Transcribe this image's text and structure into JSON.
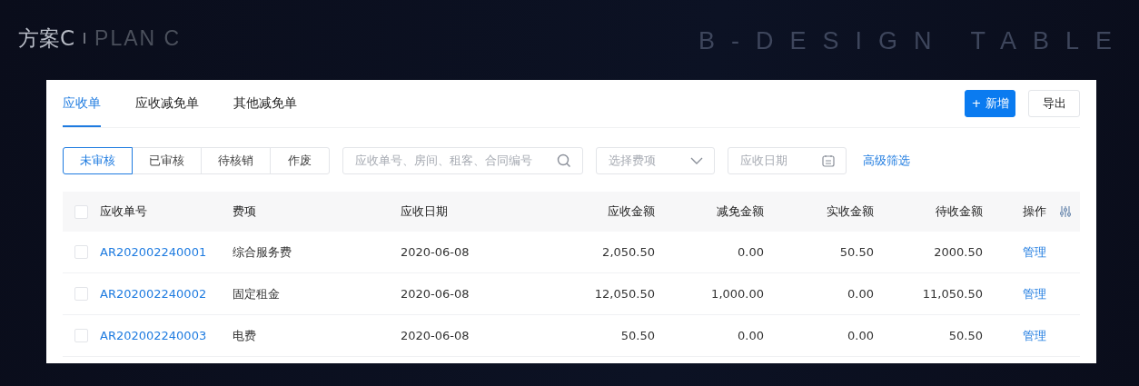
{
  "header": {
    "title": "方案C",
    "subtitle": "PLAN C",
    "brand": "B-DESIGN TABLE"
  },
  "tabs": [
    {
      "label": "应收单",
      "selected": true
    },
    {
      "label": "应收减免单",
      "selected": false
    },
    {
      "label": "其他减免单",
      "selected": false
    }
  ],
  "actions": [
    {
      "label": "+ 新增",
      "kind": "primary"
    },
    {
      "label": "导出",
      "kind": "default"
    }
  ],
  "status_filters": [
    {
      "label": "未审核",
      "selected": true
    },
    {
      "label": "已审核",
      "selected": false
    },
    {
      "label": "待核销",
      "selected": false
    },
    {
      "label": "作废",
      "selected": false
    }
  ],
  "search": {
    "placeholder": "应收单号、房间、租客、合同编号"
  },
  "fee_select": {
    "placeholder": "选择费项"
  },
  "date_field": {
    "placeholder": "应收日期"
  },
  "advanced_filter": "高级筛选",
  "table": {
    "select_all_checked": false,
    "columns": [
      "应收单号",
      "费项",
      "应收日期",
      "应收金额",
      "减免金额",
      "实收金额",
      "待收金额",
      "操作"
    ],
    "rows": [
      {
        "checked": false,
        "cells": [
          "AR202002240001",
          "综合服务费",
          "2020-06-08",
          "2,050.50",
          "0.00",
          "50.50",
          "2000.50",
          "管理"
        ]
      },
      {
        "checked": false,
        "cells": [
          "AR202002240002",
          "固定租金",
          "2020-06-08",
          "12,050.50",
          "1,000.00",
          "0.00",
          "11,050.50",
          "管理"
        ]
      },
      {
        "checked": false,
        "cells": [
          "AR202002240003",
          "电费",
          "2020-06-08",
          "50.50",
          "0.00",
          "0.00",
          "50.50",
          "管理"
        ]
      }
    ]
  }
}
